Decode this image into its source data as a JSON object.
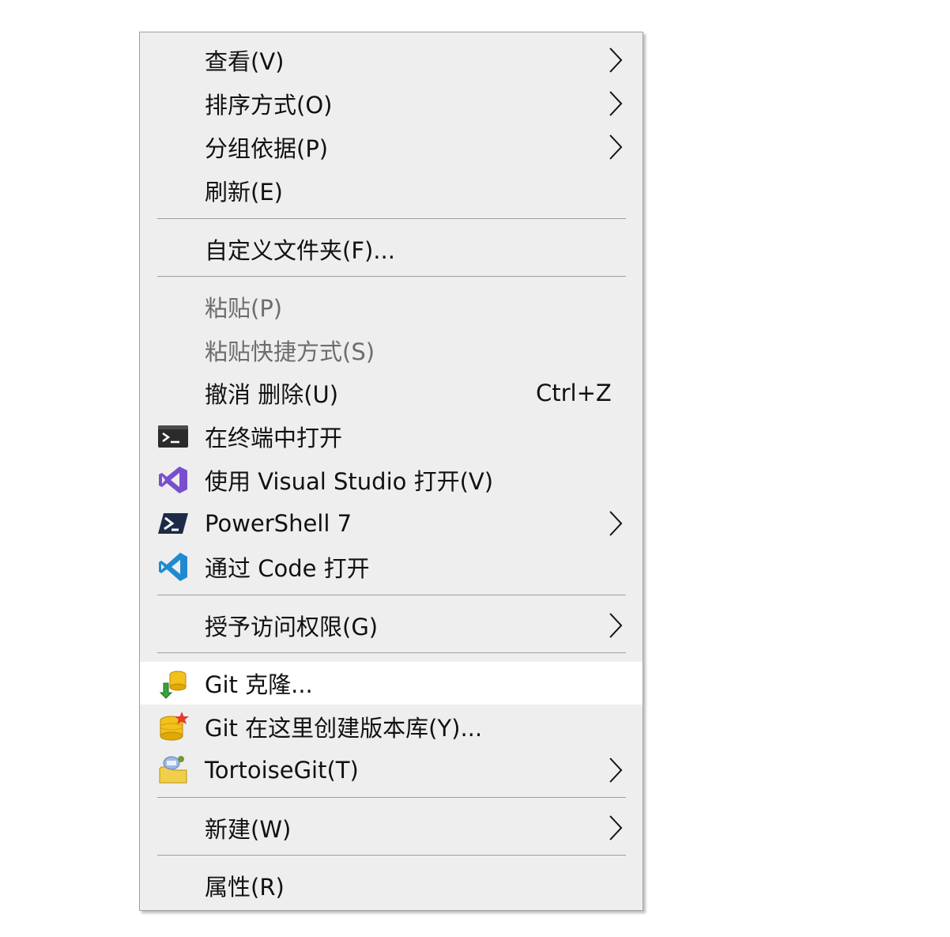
{
  "menu": {
    "items": [
      {
        "label": "查看(V)",
        "has_submenu": true,
        "disabled": false
      },
      {
        "label": "排序方式(O)",
        "has_submenu": true,
        "disabled": false
      },
      {
        "label": "分组依据(P)",
        "has_submenu": true,
        "disabled": false
      },
      {
        "label": "刷新(E)",
        "has_submenu": false,
        "disabled": false
      },
      {
        "label": "自定义文件夹(F)...",
        "has_submenu": false,
        "disabled": false
      },
      {
        "label": "粘贴(P)",
        "has_submenu": false,
        "disabled": true
      },
      {
        "label": "粘贴快捷方式(S)",
        "has_submenu": false,
        "disabled": true
      },
      {
        "label": "撤消 删除(U)",
        "shortcut": "Ctrl+Z",
        "has_submenu": false,
        "disabled": false
      },
      {
        "label": "在终端中打开",
        "icon": "terminal-icon",
        "has_submenu": false,
        "disabled": false
      },
      {
        "label": "使用 Visual Studio 打开(V)",
        "icon": "visual-studio-icon",
        "has_submenu": false,
        "disabled": false
      },
      {
        "label": "PowerShell 7",
        "icon": "powershell-icon",
        "has_submenu": true,
        "disabled": false
      },
      {
        "label": "通过 Code 打开",
        "icon": "vscode-icon",
        "has_submenu": false,
        "disabled": false
      },
      {
        "label": "授予访问权限(G)",
        "has_submenu": true,
        "disabled": false
      },
      {
        "label": "Git 克隆...",
        "icon": "git-clone-icon",
        "has_submenu": false,
        "disabled": false,
        "highlighted": true
      },
      {
        "label": "Git 在这里创建版本库(Y)...",
        "icon": "git-create-repo-icon",
        "has_submenu": false,
        "disabled": false
      },
      {
        "label": "TortoiseGit(T)",
        "icon": "tortoisegit-icon",
        "has_submenu": true,
        "disabled": false
      },
      {
        "label": "新建(W)",
        "has_submenu": true,
        "disabled": false
      },
      {
        "label": "属性(R)",
        "has_submenu": false,
        "disabled": false
      }
    ]
  },
  "colors": {
    "menu_background": "#eeeeee",
    "highlight_background": "#ffffff",
    "separator": "#a0a0a0",
    "text": "#111111",
    "disabled_text": "#6d6d6d",
    "vs_purple": "#7a4fcf",
    "vscode_blue": "#1f8ad2",
    "powershell_navy": "#1d2b49"
  }
}
